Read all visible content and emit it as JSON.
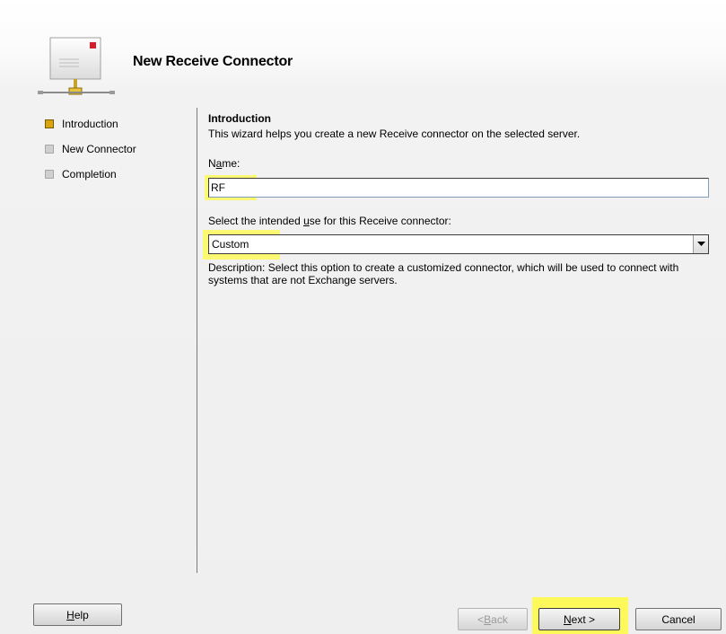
{
  "dialog": {
    "title": "New Receive Connector"
  },
  "steps": [
    {
      "label": "Introduction",
      "state": "active"
    },
    {
      "label": "New Connector",
      "state": "pending"
    },
    {
      "label": "Completion",
      "state": "pending"
    }
  ],
  "intro": {
    "heading": "Introduction",
    "text": "This wizard helps you create a new Receive connector on the selected server."
  },
  "name_field": {
    "label_pre": "N",
    "label_mnemonic": "a",
    "label_post": "me:",
    "value": "RF"
  },
  "use_field": {
    "label_pre": "Select the intended ",
    "label_mnemonic": "u",
    "label_post": "se for this Receive connector:",
    "selected": "Custom"
  },
  "description": "Description: Select this option to create a customized connector, which will be used to connect with systems that are not Exchange servers.",
  "buttons": {
    "help_mnemonic": "H",
    "help_rest": "elp",
    "back_pre": "< ",
    "back_mnemonic": "B",
    "back_rest": "ack",
    "next_mnemonic": "N",
    "next_rest": "ext >",
    "cancel": "Cancel"
  },
  "highlight_color": "#fdf95a",
  "active_step_color": "#d9a410"
}
